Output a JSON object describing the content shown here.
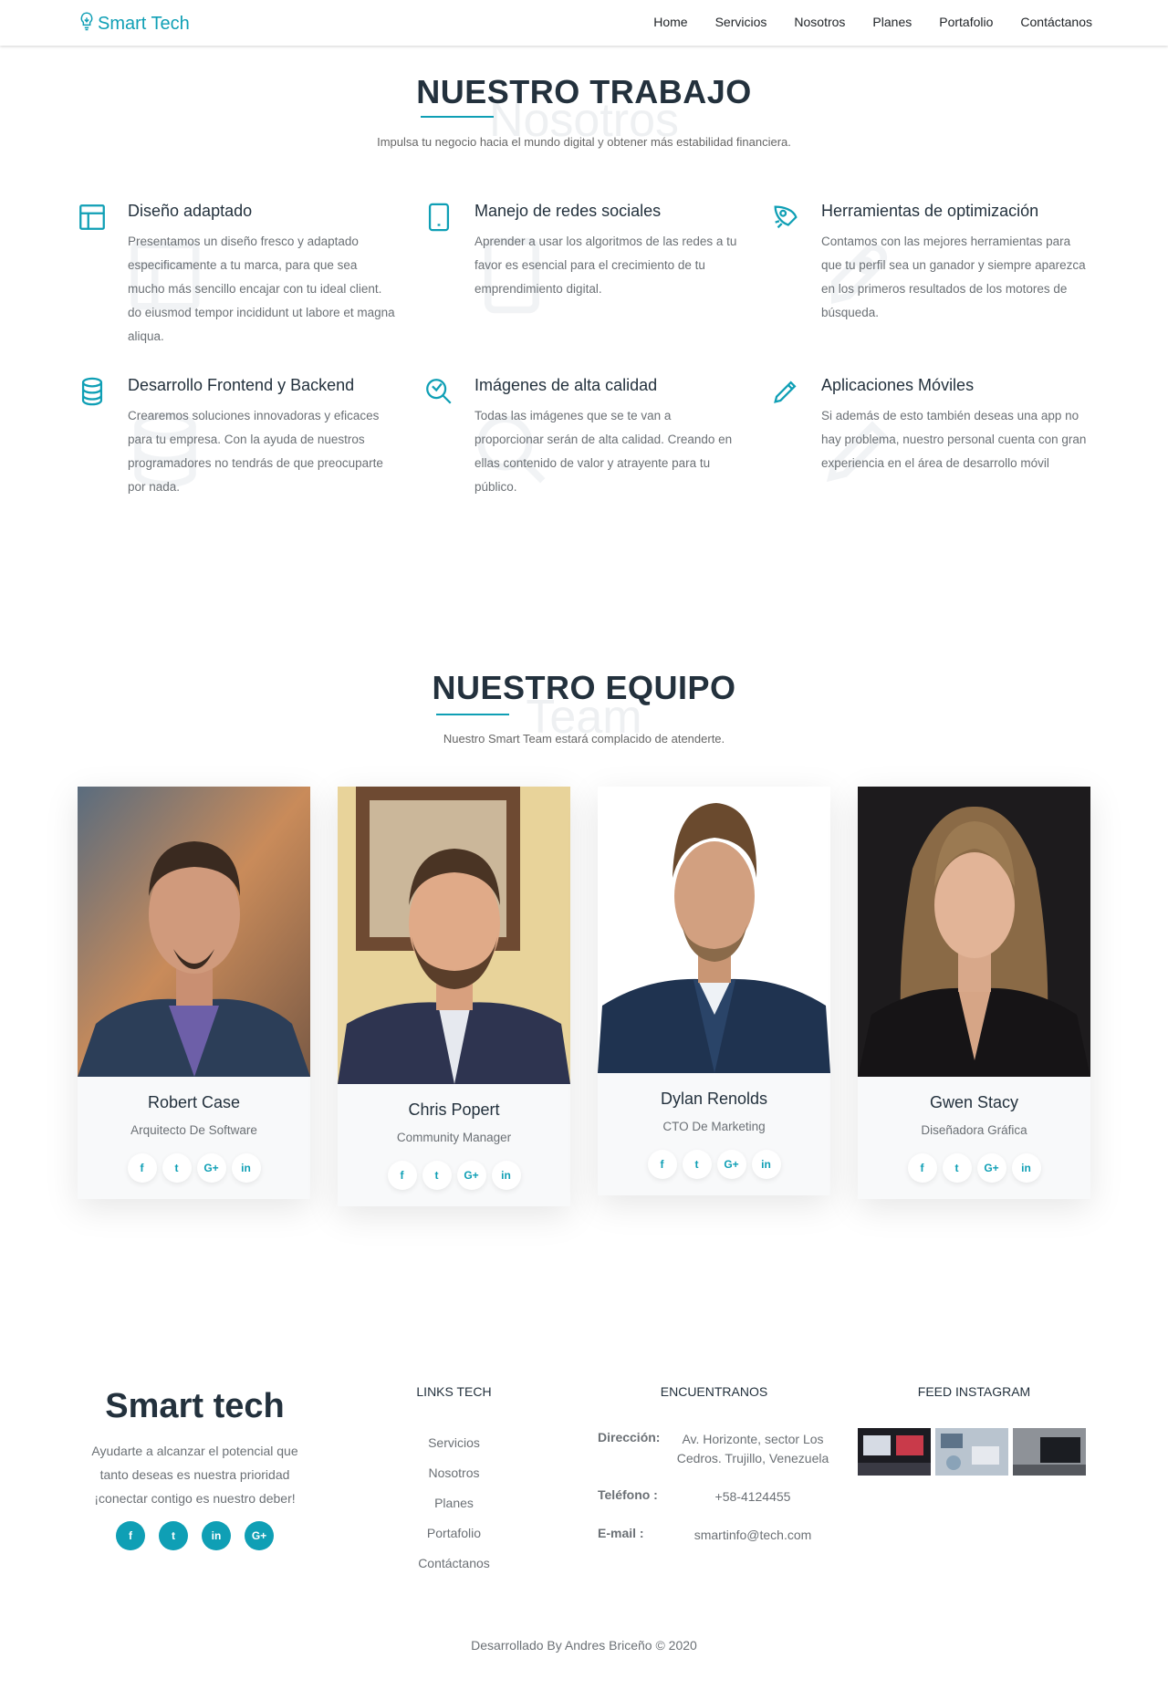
{
  "nav": {
    "brand": "Smart Tech",
    "links": [
      "Home",
      "Servicios",
      "Nosotros",
      "Planes",
      "Portafolio",
      "Contáctanos"
    ]
  },
  "work": {
    "title": "NUESTRO TRABAJO",
    "ghost": "Nosotros",
    "subtitle": "Impulsa tu negocio hacia el mundo digital y obtener más estabilidad financiera.",
    "services": [
      {
        "icon": "layout-icon",
        "title": "Diseño adaptado",
        "text": "Presentamos un diseño fresco y adaptado especificamente a tu marca, para que sea mucho más sencillo encajar con tu ideal client.",
        "text2": "do eiusmod tempor incididunt ut labore et magna aliqua."
      },
      {
        "icon": "tablet-icon",
        "title": "Manejo de redes sociales",
        "text": "Aprender a usar los algoritmos de las redes a tu favor es esencial para el crecimiento de tu emprendimiento digital."
      },
      {
        "icon": "rocket-icon",
        "title": "Herramientas de optimización",
        "text": "Contamos con las mejores herramientas para que tu perfil sea un ganador y siempre aparezca en los primeros resultados de los motores de búsqueda."
      },
      {
        "icon": "database-icon",
        "title": "Desarrollo Frontend y Backend",
        "text": "Crearemos soluciones innovadoras y eficaces para tu empresa. Con la ayuda de nuestros programadores no tendrás de que preocuparte por nada."
      },
      {
        "icon": "search-icon",
        "title": "Imágenes de alta calidad",
        "text": "Todas las imágenes que se te van a proporcionar serán de alta calidad. Creando en ellas contenido de valor y atrayente para tu público."
      },
      {
        "icon": "pencil-icon",
        "title": "Aplicaciones Móviles",
        "text": "Si además de esto también deseas una app no hay problema, nuestro personal cuenta con gran experiencia en el área de desarrollo móvil"
      }
    ]
  },
  "team": {
    "title": "NUESTRO EQUIPO",
    "ghost": "Team",
    "subtitle": "Nuestro Smart Team estará complacido de atenderte.",
    "members": [
      {
        "name": "Robert Case",
        "role": "Arquitecto De Software"
      },
      {
        "name": "Chris Popert",
        "role": "Community Manager"
      },
      {
        "name": "Dylan Renolds",
        "role": "CTO De Marketing"
      },
      {
        "name": "Gwen Stacy",
        "role": "Diseñadora Gráfica"
      }
    ],
    "social_glyphs": [
      "f",
      "t",
      "G+",
      "in"
    ]
  },
  "footer": {
    "brand": "Smart tech",
    "tagline": "Ayudarte a alcanzar el potencial que tanto deseas es nuestra prioridad ¡conectar contigo es nuestro deber!",
    "links_title": "LINKS TECH",
    "links": [
      "Servicios",
      "Nosotros",
      "Planes",
      "Portafolio",
      "Contáctanos"
    ],
    "contact_title": "ENCUENTRANOS",
    "address_label": "Dirección:",
    "address": "Av. Horizonte, sector Los Cedros. Trujillo, Venezuela",
    "phone_label": "Teléfono :",
    "phone": "+58-4124455",
    "email_label": "E-mail :",
    "email": "smartinfo@tech.com",
    "instagram_title": "FEED INSTAGRAM",
    "copyright": "Desarrollado By Andres Briceño © 2020"
  },
  "colors": {
    "accent": "#0f9fb5",
    "heading": "#23313d",
    "muted": "#6b7075"
  }
}
